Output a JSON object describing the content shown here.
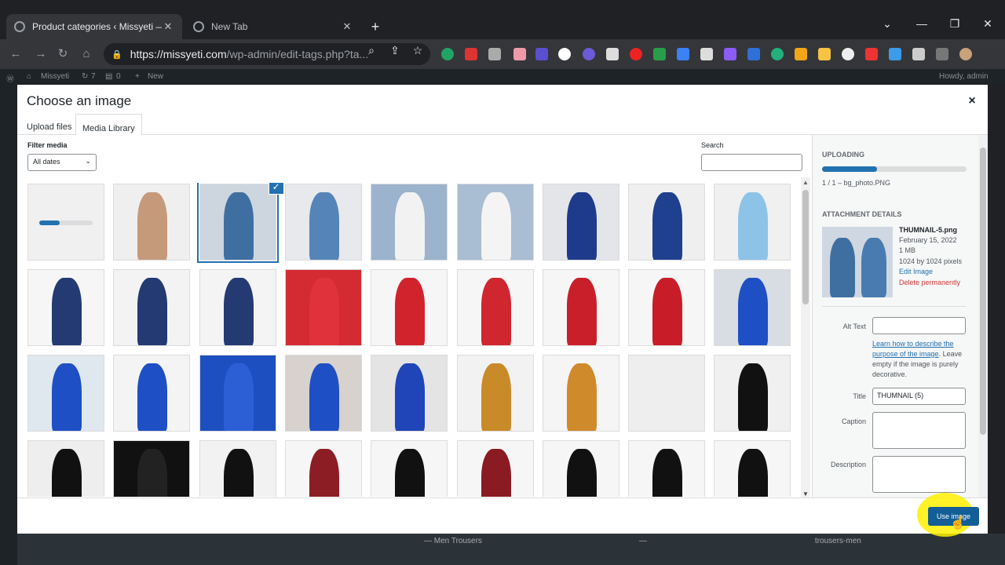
{
  "browser": {
    "tabs": [
      {
        "title": "Product categories ‹ Missyeti — W",
        "active": true
      },
      {
        "title": "New Tab",
        "active": false
      }
    ],
    "new_tab_glyph": "+",
    "url_host": "https://missyeti.com",
    "url_path": "/wp-admin/edit-tags.php?ta...",
    "window_controls": [
      "⌄",
      "—",
      "❐",
      "✕"
    ]
  },
  "adminbar": {
    "site": "Missyeti",
    "updates": "7",
    "comments": "0",
    "new": "New",
    "howdy": "Howdy, admin"
  },
  "modal": {
    "title": "Choose an image",
    "close_glyph": "×",
    "tabs": [
      "Upload files",
      "Media Library"
    ],
    "active_tab": "Media Library",
    "filter_label": "Filter media",
    "date_filter": "All dates",
    "search_label": "Search",
    "search_value": "",
    "grid": {
      "columns": 9,
      "items": [
        {
          "name": "uploading-placeholder",
          "bg": "#f0f0f1",
          "fig": "",
          "uploading": true
        },
        {
          "name": "media-item-2",
          "bg": "#efefef",
          "fig": "#c59a7a"
        },
        {
          "name": "media-item-thumbnail-5",
          "bg": "#cdd6de",
          "fig": "#3f6fa0",
          "selected": true
        },
        {
          "name": "media-item-4",
          "bg": "#e7e9ec",
          "fig": "#5584b8"
        },
        {
          "name": "media-item-5",
          "bg": "#9bb3cc",
          "fig": "#f2f2f2"
        },
        {
          "name": "media-item-6",
          "bg": "#a9bdd3",
          "fig": "#f4f4f4"
        },
        {
          "name": "media-item-7",
          "bg": "#e3e5e9",
          "fig": "#1e3a8a"
        },
        {
          "name": "media-item-8",
          "bg": "#efefef",
          "fig": "#1f3f8f"
        },
        {
          "name": "media-item-9",
          "bg": "#f0f0f0",
          "fig": "#8ec3e8"
        },
        {
          "name": "media-item-10",
          "bg": "#f6f6f6",
          "fig": "#233a72"
        },
        {
          "name": "media-item-11",
          "bg": "#f3f3f3",
          "fig": "#233a72"
        },
        {
          "name": "media-item-12",
          "bg": "#f4f4f4",
          "fig": "#233a72"
        },
        {
          "name": "media-item-13",
          "bg": "#d42a32",
          "fig": "#e0323a"
        },
        {
          "name": "media-item-14",
          "bg": "#f6f6f6",
          "fig": "#d1232c"
        },
        {
          "name": "media-item-15",
          "bg": "#f6f6f6",
          "fig": "#cf2630"
        },
        {
          "name": "media-item-16",
          "bg": "#f6f6f6",
          "fig": "#c91f2a"
        },
        {
          "name": "media-item-17",
          "bg": "#f6f6f6",
          "fig": "#c81d28"
        },
        {
          "name": "media-item-18",
          "bg": "#d8dde3",
          "fig": "#1f4fc4"
        },
        {
          "name": "media-item-19",
          "bg": "#dfe7ef",
          "fig": "#1f4fc4"
        },
        {
          "name": "media-item-20",
          "bg": "#f4f4f4",
          "fig": "#1f4fc4"
        },
        {
          "name": "media-item-21",
          "bg": "#1e4fc0",
          "fig": "#2c5fd6"
        },
        {
          "name": "media-item-22",
          "bg": "#d7d2cd",
          "fig": "#1f4fc4"
        },
        {
          "name": "media-item-23",
          "bg": "#e4e4e4",
          "fig": "#1f45b8"
        },
        {
          "name": "media-item-24",
          "bg": "#f2f2f2",
          "fig": "#c98a2a"
        },
        {
          "name": "media-item-25",
          "bg": "#f5f5f5",
          "fig": "#cf8a2b"
        },
        {
          "name": "media-item-26",
          "bg": "#eeeeee",
          "fig": ""
        },
        {
          "name": "media-item-27",
          "bg": "#f0f0f0",
          "fig": "#111111"
        },
        {
          "name": "media-item-28",
          "bg": "#eeeeee",
          "fig": "#111111"
        },
        {
          "name": "media-item-29",
          "bg": "#111111",
          "fig": "#222222"
        },
        {
          "name": "media-item-30",
          "bg": "#f2f2f2",
          "fig": "#111111"
        },
        {
          "name": "media-item-31",
          "bg": "#f6f6f6",
          "fig": "#8c1d24"
        },
        {
          "name": "media-item-32",
          "bg": "#f6f6f6",
          "fig": "#111111"
        },
        {
          "name": "media-item-33",
          "bg": "#f6f6f6",
          "fig": "#8a1b22"
        },
        {
          "name": "media-item-34",
          "bg": "#f6f6f6",
          "fig": "#111111"
        },
        {
          "name": "media-item-35",
          "bg": "#f6f6f6",
          "fig": "#111111"
        },
        {
          "name": "media-item-36",
          "bg": "#f6f6f6",
          "fig": "#111111"
        }
      ]
    },
    "sidebar": {
      "uploading_heading": "UPLOADING",
      "upload_progress": 0.38,
      "upload_count": "1 / 1  –  bg_photo.PNG",
      "details_heading": "ATTACHMENT DETAILS",
      "filename": "THUMNAIL-5.png",
      "date": "February 15, 2022",
      "size": "1 MB",
      "dimensions": "1024 by 1024 pixels",
      "edit_link": "Edit Image",
      "delete_link": "Delete permanently",
      "alt_label": "Alt Text",
      "alt_value": "",
      "alt_help_link": "Learn how to describe the purpose of the image",
      "alt_help_text": ". Leave empty if the image is purely decorative.",
      "title_label": "Title",
      "title_value": "THUMNAIL (5)",
      "caption_label": "Caption",
      "description_label": "Description"
    },
    "use_image_label": "Use image"
  },
  "background": {
    "row_text": "— Men Trousers",
    "row_slug": "trousers-men"
  },
  "colors": {
    "wp_blue": "#2271b1",
    "button_blue": "#135e96",
    "delete_red": "#d63638",
    "chrome_dark": "#202124"
  }
}
